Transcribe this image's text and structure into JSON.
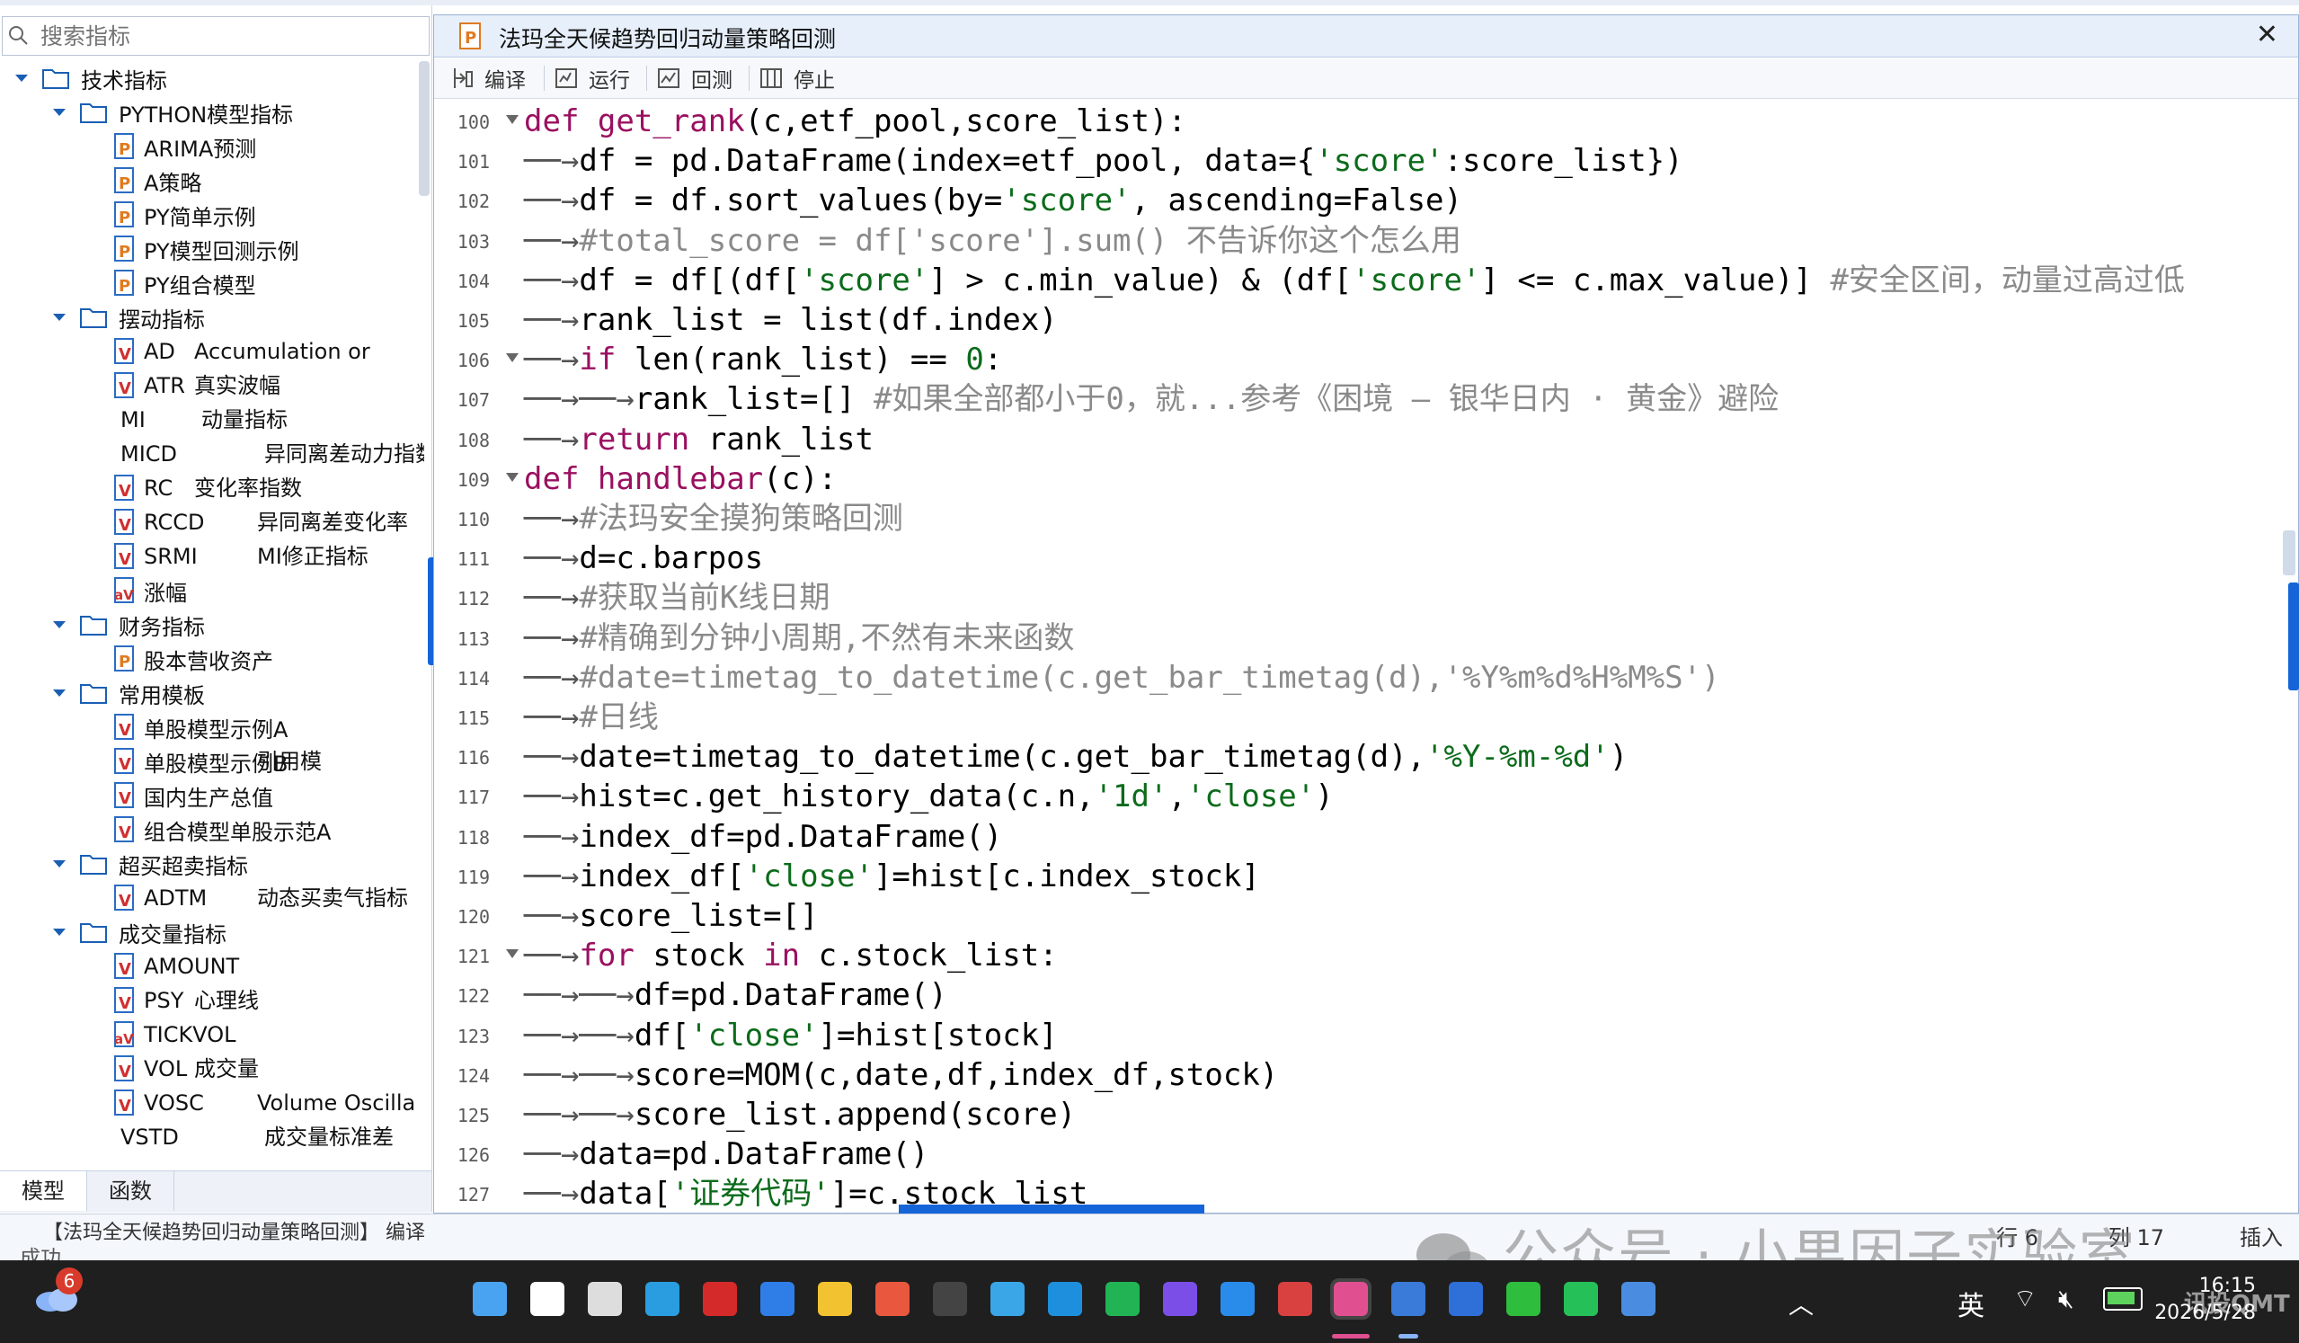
{
  "sidebar": {
    "search_placeholder": "搜索指标",
    "tree": [
      {
        "level": 0,
        "type": "folder",
        "label": "技术指标"
      },
      {
        "level": 1,
        "type": "folder",
        "label": "PYTHON模型指标"
      },
      {
        "level": 2,
        "type": "p",
        "label": "ARIMA预测",
        "desc": ""
      },
      {
        "level": 2,
        "type": "p",
        "label": "A策略",
        "desc": ""
      },
      {
        "level": 2,
        "type": "p",
        "label": "PY简单示例",
        "desc": ""
      },
      {
        "level": 2,
        "type": "p",
        "label": "PY模型回测示例",
        "desc": ""
      },
      {
        "level": 2,
        "type": "p",
        "label": "PY组合模型",
        "desc": ""
      },
      {
        "level": 1,
        "type": "folder",
        "label": "摆动指标"
      },
      {
        "level": 2,
        "type": "v",
        "label": "AD",
        "desc": "Accumulation or"
      },
      {
        "level": 2,
        "type": "v",
        "label": "ATR",
        "desc": "真实波幅"
      },
      {
        "level": 2,
        "type": "none",
        "label": "MI",
        "desc": "动量指标"
      },
      {
        "level": 2,
        "type": "none",
        "label": "MICD",
        "desc": "异同离差动力指数"
      },
      {
        "level": 2,
        "type": "v",
        "label": "RC",
        "desc": "变化率指数"
      },
      {
        "level": 2,
        "type": "v",
        "label": "RCCD",
        "desc": "异同离差变化率"
      },
      {
        "level": 2,
        "type": "v",
        "label": "SRMI",
        "desc": "MI修正指标"
      },
      {
        "level": 2,
        "type": "av",
        "label": "涨幅",
        "desc": ""
      },
      {
        "level": 1,
        "type": "folder",
        "label": "财务指标"
      },
      {
        "level": 2,
        "type": "p",
        "label": "股本营收资产",
        "desc": ""
      },
      {
        "level": 1,
        "type": "folder",
        "label": "常用模板"
      },
      {
        "level": 2,
        "type": "v",
        "label": "单股模型示例A",
        "desc": ""
      },
      {
        "level": 2,
        "type": "v",
        "label": "单股模型示例B",
        "desc": "引用模"
      },
      {
        "level": 2,
        "type": "v",
        "label": "国内生产总值",
        "desc": ""
      },
      {
        "level": 2,
        "type": "v",
        "label": "组合模型单股示范A",
        "desc": ""
      },
      {
        "level": 1,
        "type": "folder",
        "label": "超买超卖指标"
      },
      {
        "level": 2,
        "type": "v",
        "label": "ADTM",
        "desc": "动态买卖气指标"
      },
      {
        "level": 1,
        "type": "folder",
        "label": "成交量指标"
      },
      {
        "level": 2,
        "type": "v",
        "label": "AMOUNT",
        "desc": ""
      },
      {
        "level": 2,
        "type": "v",
        "label": "PSY",
        "desc": "心理线"
      },
      {
        "level": 2,
        "type": "av",
        "label": "TICKVOL",
        "desc": ""
      },
      {
        "level": 2,
        "type": "v",
        "label": "VOL",
        "desc": "成交量"
      },
      {
        "level": 2,
        "type": "v",
        "label": "VOSC",
        "desc": "Volume Oscilla"
      },
      {
        "level": 2,
        "type": "none",
        "label": "VSTD",
        "desc": "成交量标准差"
      }
    ],
    "bottom_tabs": [
      "模型",
      "函数"
    ]
  },
  "editor": {
    "tab_title": "法玛全天候趋势回归动量策略回测",
    "close_label": "✕",
    "toolbar": [
      {
        "label": "编译",
        "icon": "compile-icon"
      },
      {
        "label": "运行",
        "icon": "run-icon"
      },
      {
        "label": "回测",
        "icon": "backtest-icon"
      },
      {
        "label": "停止",
        "icon": "stop-icon"
      }
    ],
    "lines": [
      {
        "n": "100",
        "fold": true,
        "html": "<span class='kw'>def</span> <span class='fn'>get_rank</span>(c,etf_pool,score_list):"
      },
      {
        "n": "101",
        "fold": false,
        "html": "<span class='tabarrow'>──→</span>df = pd.DataFrame(index=etf_pool, data={<span class='str'>'score'</span>:score_list})"
      },
      {
        "n": "102",
        "fold": false,
        "html": "<span class='tabarrow'>──→</span>df = df.sort_values(by=<span class='str'>'score'</span>, ascending=False)"
      },
      {
        "n": "103",
        "fold": false,
        "html": "<span class='tabarrow'>──→</span><span class='cm'>#total_score = df['score'].sum() 不告诉你这个怎么用</span>"
      },
      {
        "n": "104",
        "fold": false,
        "html": "<span class='tabarrow'>──→</span>df = df[(df[<span class='str'>'score'</span>] > c.min_value) & (df[<span class='str'>'score'</span>] <= c.max_value)] <span class='cm'>#安全区间，动量过高过低</span>"
      },
      {
        "n": "105",
        "fold": false,
        "html": "<span class='tabarrow'>──→</span>rank_list = list(df.index)"
      },
      {
        "n": "106",
        "fold": true,
        "html": "<span class='tabarrow'>──→</span><span class='kw'>if</span> len(rank_list) == <span class='num'>0</span>:"
      },
      {
        "n": "107",
        "fold": false,
        "html": "<span class='tabarrow'>──→──→</span>rank_list=[] <span class='cm'>#如果全部都小于0，就...参考《困境 — 银华日内 · 黄金》避险</span>"
      },
      {
        "n": "108",
        "fold": false,
        "html": "<span class='tabarrow'>──→</span><span class='kw'>return</span> rank_list"
      },
      {
        "n": "109",
        "fold": true,
        "html": "<span class='kw'>def</span> <span class='fn'>handlebar</span>(c):"
      },
      {
        "n": "110",
        "fold": false,
        "html": "<span class='tabarrow'>──→</span><span class='cm'>#法玛安全摸狗策略回测</span>"
      },
      {
        "n": "111",
        "fold": false,
        "html": "<span class='tabarrow'>──→</span>d=c.barpos"
      },
      {
        "n": "112",
        "fold": false,
        "html": "<span class='tabarrow'>──→</span><span class='cm'>#获取当前K线日期</span>"
      },
      {
        "n": "113",
        "fold": false,
        "html": "<span class='tabarrow'>──→</span><span class='cm'>#精确到分钟小周期,不然有未来函数</span>"
      },
      {
        "n": "114",
        "fold": false,
        "html": "<span class='tabarrow'>──→</span><span class='cm'>#date=timetag_to_datetime(c.get_bar_timetag(d),'%Y%m%d%H%M%S')</span>"
      },
      {
        "n": "115",
        "fold": false,
        "html": "<span class='tabarrow'>──→</span><span class='cm'>#日线</span>"
      },
      {
        "n": "116",
        "fold": false,
        "html": "<span class='tabarrow'>──→</span>date=timetag_to_datetime(c.get_bar_timetag(d),<span class='str'>'%Y-%m-%d'</span>)"
      },
      {
        "n": "117",
        "fold": false,
        "html": "<span class='tabarrow'>──→</span>hist=c.get_history_data(c.n,<span class='str'>'1d'</span>,<span class='str'>'close'</span>)"
      },
      {
        "n": "118",
        "fold": false,
        "html": "<span class='tabarrow'>──→</span>index_df=pd.DataFrame()"
      },
      {
        "n": "119",
        "fold": false,
        "html": "<span class='tabarrow'>──→</span>index_df[<span class='str'>'close'</span>]=hist[c.index_stock]"
      },
      {
        "n": "120",
        "fold": false,
        "html": "<span class='tabarrow'>──→</span>score_list=[]"
      },
      {
        "n": "121",
        "fold": true,
        "html": "<span class='tabarrow'>──→</span><span class='kw'>for</span> stock <span class='kw'>in</span> c.stock_list:"
      },
      {
        "n": "122",
        "fold": false,
        "html": "<span class='tabarrow'>──→──→</span>df=pd.DataFrame()"
      },
      {
        "n": "123",
        "fold": false,
        "html": "<span class='tabarrow'>──→──→</span>df[<span class='str'>'close'</span>]=hist[stock]"
      },
      {
        "n": "124",
        "fold": false,
        "html": "<span class='tabarrow'>──→──→</span>score=MOM(c,date,df,index_df,stock)"
      },
      {
        "n": "125",
        "fold": false,
        "html": "<span class='tabarrow'>──→──→</span>score_list.append(score)"
      },
      {
        "n": "126",
        "fold": false,
        "html": "<span class='tabarrow'>──→</span>data=pd.DataFrame()"
      },
      {
        "n": "127",
        "fold": false,
        "html": "<span class='tabarrow'>──→</span>data[<span class='str'>'证券代码'</span>]=c.stock_list"
      }
    ]
  },
  "status": {
    "message": "【法玛全天候趋势回归动量策略回测】 编译",
    "message2": "成功",
    "row_label": "行 6",
    "col_label": "列 17",
    "mode_label": "插入"
  },
  "watermark": "公众号 · 小果因子实验室",
  "taskbar": {
    "notif_count": "6",
    "ime": "英",
    "time": "16:15",
    "date": "2026/5/28",
    "brand": "讯投QMT"
  }
}
